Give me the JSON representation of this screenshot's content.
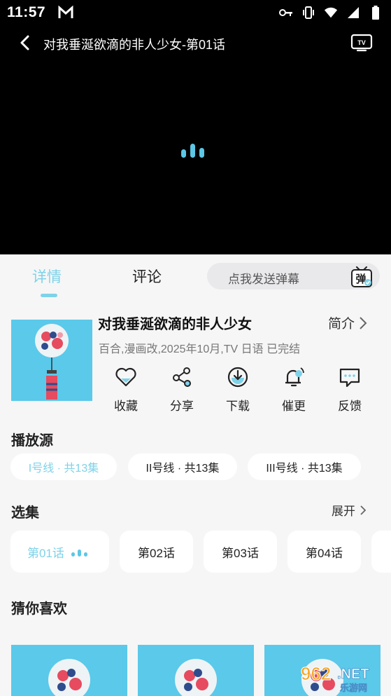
{
  "status_bar": {
    "time": "11:57",
    "icons": [
      "gmail-icon",
      "key-icon",
      "vibrate-icon",
      "wifi-icon",
      "signal-icon",
      "battery-icon"
    ]
  },
  "player": {
    "title": "对我垂涎欲滴的非人少女-第01话",
    "back_icon": "back-arrow-icon",
    "cast_icon": "tv-cast-icon"
  },
  "tabs": {
    "details": "详情",
    "comments": "评论",
    "danmaku_placeholder": "点我发送弹幕",
    "danmaku_button": "弹"
  },
  "anime": {
    "title": "对我垂涎欲滴的非人少女",
    "intro_label": "简介",
    "meta": "百合,漫画改,2025年10月,TV 日语 已完结"
  },
  "actions": [
    {
      "label": "收藏",
      "icon": "heart-icon"
    },
    {
      "label": "分享",
      "icon": "share-icon"
    },
    {
      "label": "下载",
      "icon": "download-icon"
    },
    {
      "label": "催更",
      "icon": "bell-icon"
    },
    {
      "label": "反馈",
      "icon": "feedback-icon"
    }
  ],
  "sources": {
    "heading": "播放源",
    "items": [
      {
        "label": "I号线 · 共13集",
        "active": true
      },
      {
        "label": "II号线 · 共13集",
        "active": false
      },
      {
        "label": "III号线 · 共13集",
        "active": false
      }
    ]
  },
  "episodes": {
    "heading": "选集",
    "expand_label": "展开",
    "items": [
      {
        "label": "第01话",
        "active": true
      },
      {
        "label": "第02话",
        "active": false
      },
      {
        "label": "第03话",
        "active": false
      },
      {
        "label": "第04话",
        "active": false
      }
    ]
  },
  "recommend": {
    "heading": "猜你喜欢"
  },
  "colors": {
    "accent": "#7fd2e8",
    "cover_bg": "#5ac9ea",
    "video_bg": "#000000",
    "panel_bg": "#f6f6f7"
  }
}
